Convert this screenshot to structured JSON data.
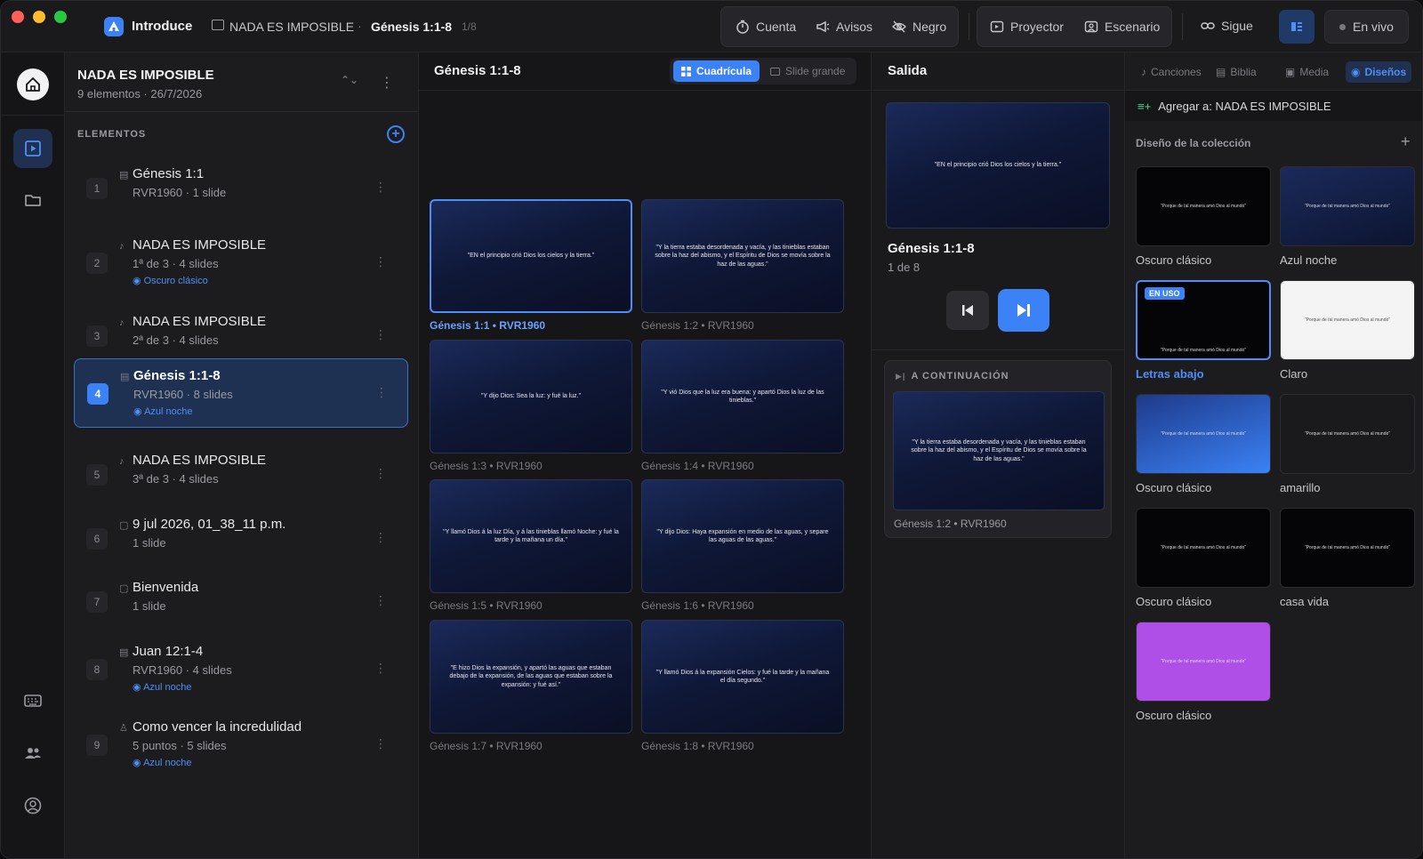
{
  "app": {
    "name": "Introduce",
    "breadcrumb": [
      "NADA ES IMPOSIBLE",
      "Génesis 1:1-8"
    ],
    "breadcrumb_sep": "·",
    "position": "1/8",
    "accent": "#3b82f6"
  },
  "toolbar": {
    "group1": [
      {
        "label": "Cuenta",
        "icon": "timer-icon"
      },
      {
        "label": "Avisos",
        "icon": "megaphone-icon"
      },
      {
        "label": "Negro",
        "icon": "eye-off-icon"
      }
    ],
    "group2": [
      {
        "label": "Proyector",
        "icon": "projector-icon"
      },
      {
        "label": "Escenario",
        "icon": "stage-icon"
      }
    ],
    "follow_label": "Sigue",
    "live_label": "En vivo"
  },
  "list": {
    "title": "NADA ES IMPOSIBLE",
    "subtitle": "9 elementos  ·  26/7/2026",
    "elements_label": "ELEMENTOS",
    "add_label": "+",
    "items": [
      {
        "num": "1",
        "icon": "book-icon",
        "title": "Génesis 1:1",
        "meta": "RVR1960  ·  1 slide",
        "theme": ""
      },
      {
        "num": "2",
        "icon": "music-icon",
        "title": "NADA ES IMPOSIBLE",
        "meta": "1ª de 3  ·  4 slides",
        "theme": "Oscuro clásico"
      },
      {
        "num": "3",
        "icon": "music-icon",
        "title": "NADA ES IMPOSIBLE",
        "meta": "2ª de 3  ·  4 slides",
        "theme": ""
      },
      {
        "num": "4",
        "icon": "book-icon",
        "title": "Génesis 1:1-8",
        "meta": "RVR1960  ·  8 slides",
        "theme": "Azul noche"
      },
      {
        "num": "5",
        "icon": "music-icon",
        "title": "NADA ES IMPOSIBLE",
        "meta": "3ª de 3  ·  4 slides",
        "theme": ""
      },
      {
        "num": "6",
        "icon": "slide-icon",
        "title": "9 jul 2026, 01_38_11 p.m.",
        "meta": "1 slide",
        "theme": ""
      },
      {
        "num": "7",
        "icon": "slide-icon",
        "title": "Bienvenida",
        "meta": "1 slide",
        "theme": ""
      },
      {
        "num": "8",
        "icon": "book-icon",
        "title": "Juan 12:1-4",
        "meta": "RVR1960  ·  4 slides",
        "theme": "Azul noche"
      },
      {
        "num": "9",
        "icon": "mic-icon",
        "title": "Como vencer la incredulidad",
        "meta": "5 puntos  ·  5 slides",
        "theme": "Azul noche"
      }
    ]
  },
  "grid": {
    "title": "Génesis 1:1-8",
    "view_grid": "Cuadrícula",
    "view_large": "Slide grande",
    "slides": [
      {
        "text": "\"EN el principio crió Dios los cielos y la tierra.\"",
        "caption": "Génesis 1:1 • RVR1960"
      },
      {
        "text": "\"Y la tierra estaba desordenada y vacía, y las tinieblas estaban sobre la haz del abismo, y el Espíritu de Dios se movía sobre la haz de las aguas.\"",
        "caption": "Génesis 1:2 • RVR1960"
      },
      {
        "text": "\"Y dijo Dios: Sea la luz: y fué la luz.\"",
        "caption": "Génesis 1:3 • RVR1960"
      },
      {
        "text": "\"Y vió Dios que la luz era buena: y apartó Dios la luz de las tinieblas.\"",
        "caption": "Génesis 1:4 • RVR1960"
      },
      {
        "text": "\"Y llamó Dios á la luz Día, y á las tinieblas llamó Noche: y fué la tarde y la mañana un día.\"",
        "caption": "Génesis 1:5 • RVR1960"
      },
      {
        "text": "\"Y dijo Dios: Haya expansión en medio de las aguas, y separe las aguas de las aguas.\"",
        "caption": "Génesis 1:6 • RVR1960"
      },
      {
        "text": "\"E hizo Dios la expansión, y apartó las aguas que estaban debajo de la expansión, de las aguas que estaban sobre la expansión: y fué así.\"",
        "caption": "Génesis 1:7 • RVR1960"
      },
      {
        "text": "\"Y llamó Dios á la expansión Cielos: y fué la tarde y la mañana el día segundo.\"",
        "caption": "Génesis 1:8 • RVR1960"
      }
    ]
  },
  "output": {
    "title": "Salida",
    "current_text": "\"EN el principio crió Dios los cielos y la tierra.\"",
    "current_name": "Génesis 1:1-8",
    "current_pos": "1 de 8",
    "next_label": "A CONTINUACIÓN",
    "next_text": "\"Y la tierra estaba desordenada y vacía, y las tinieblas estaban sobre la haz del abismo, y el Espíritu de Dios se movía sobre la haz de las aguas.\"",
    "next_caption": "Génesis 1:2 • RVR1960"
  },
  "right": {
    "tabs": [
      {
        "label": "Canciones",
        "icon": "music-icon"
      },
      {
        "label": "Biblia",
        "icon": "book-icon"
      },
      {
        "label": "Media",
        "icon": "image-icon"
      },
      {
        "label": "Diseños",
        "icon": "palette-icon"
      }
    ],
    "add_to": "Agregar a: NADA ES IMPOSIBLE",
    "section_title": "Diseño de la colección",
    "section_add": "+",
    "in_use_badge": "EN USO",
    "theme_sample": "\"Porque de tal manera amó Dios al mundo\"",
    "themes": [
      {
        "name": "Oscuro clásico",
        "bg": "#050507"
      },
      {
        "name": "Azul noche",
        "bg": "#14204a"
      },
      {
        "name": "Letras abajo",
        "bg": "#050507"
      },
      {
        "name": "Claro",
        "bg": "#f4f4f4"
      },
      {
        "name": "Oscuro clásico",
        "bg": "#2a55c8"
      },
      {
        "name": "amarillo",
        "bg": "#1a1a1c"
      },
      {
        "name": "Oscuro clásico",
        "bg": "#050507"
      },
      {
        "name": "casa vida",
        "bg": "#050507"
      },
      {
        "name": "Oscuro clásico",
        "bg": "#b04fe8"
      }
    ]
  }
}
